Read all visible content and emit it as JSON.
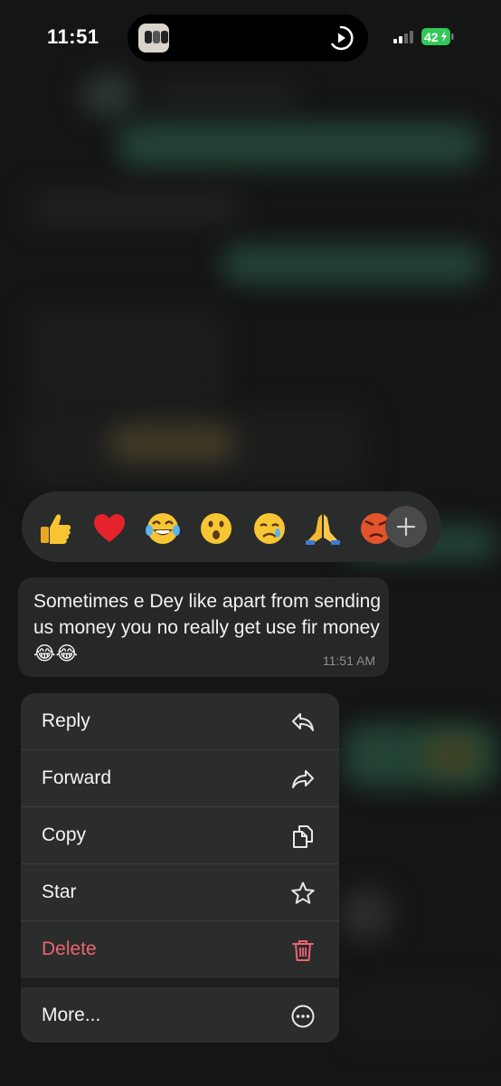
{
  "status_bar": {
    "time": "11:51",
    "battery": "42"
  },
  "reactions": {
    "emojis": [
      "👍",
      "❤️",
      "😂",
      "😮",
      "😢",
      "🙏",
      "😡"
    ],
    "more_icon": "plus-icon"
  },
  "message": {
    "text": "Sometimes e Dey like apart from sending us money you no really get use fir money 😂😂",
    "time": "11:51 AM"
  },
  "menu": {
    "items": [
      {
        "label": "Reply",
        "icon": "reply-icon"
      },
      {
        "label": "Forward",
        "icon": "forward-icon"
      },
      {
        "label": "Copy",
        "icon": "copy-icon"
      },
      {
        "label": "Star",
        "icon": "star-icon"
      },
      {
        "label": "Delete",
        "icon": "trash-icon"
      },
      {
        "label": "More...",
        "icon": "more-icon"
      }
    ]
  },
  "colors": {
    "delete": "#ec6372",
    "battery": "#34c759"
  }
}
